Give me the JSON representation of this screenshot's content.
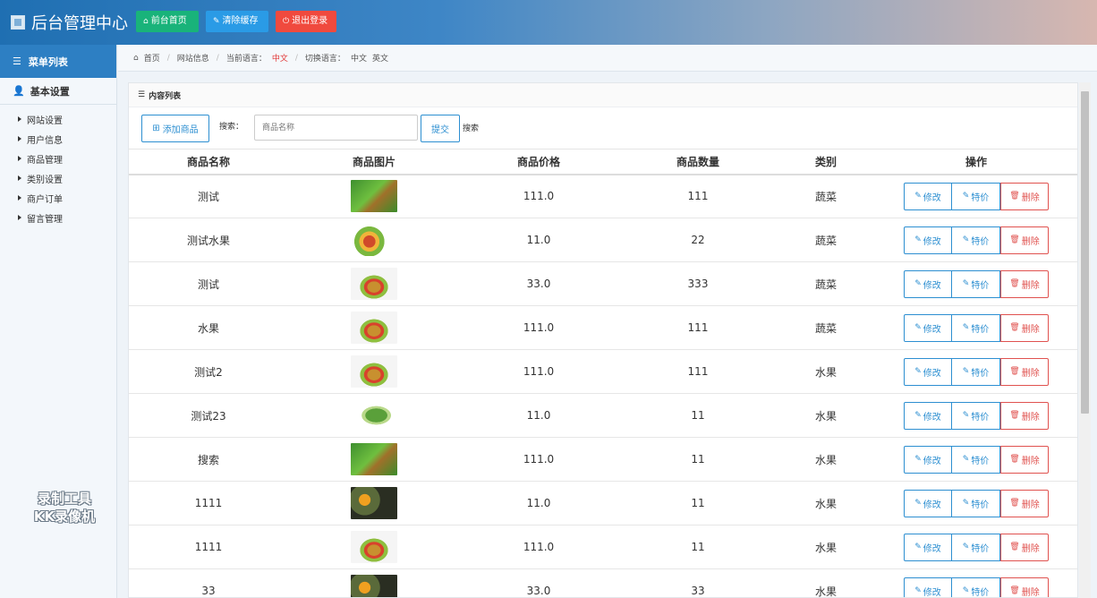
{
  "header": {
    "title": "后台管理中心",
    "buttons": {
      "home": "前台首页",
      "cache": "清除缓存",
      "logout": "退出登录"
    }
  },
  "sidebar": {
    "menu_title": "菜单列表",
    "group_title": "基本设置",
    "items": [
      "网站设置",
      "用户信息",
      "商品管理",
      "类别设置",
      "商户订单",
      "留言管理"
    ]
  },
  "breadcrumb": {
    "home": "首页",
    "page": "网站信息",
    "lang_label": "当前语言：",
    "lang_value": "中文",
    "switch_label": "切换语言：",
    "switch_zh": "中文",
    "switch_en": "英文"
  },
  "panel": {
    "title": "内容列表",
    "add_button": "添加商品",
    "search_label": "搜索：",
    "search_placeholder": "商品名称",
    "submit_button": "提交",
    "search_text": "搜索"
  },
  "table": {
    "headers": [
      "商品名称",
      "商品图片",
      "商品价格",
      "商品数量",
      "类别",
      "操作"
    ],
    "actions": {
      "edit": "修改",
      "special": "特价",
      "delete": "删除"
    },
    "rows": [
      {
        "name": "测试",
        "price": "111.0",
        "qty": "111",
        "category": "蔬菜"
      },
      {
        "name": "测试水果",
        "price": "11.0",
        "qty": "22",
        "category": "蔬菜"
      },
      {
        "name": "测试",
        "price": "33.0",
        "qty": "333",
        "category": "蔬菜"
      },
      {
        "name": "水果",
        "price": "111.0",
        "qty": "111",
        "category": "蔬菜"
      },
      {
        "name": "测试2",
        "price": "111.0",
        "qty": "111",
        "category": "水果"
      },
      {
        "name": "测试23",
        "price": "11.0",
        "qty": "11",
        "category": "水果"
      },
      {
        "name": "搜索",
        "price": "111.0",
        "qty": "11",
        "category": "水果"
      },
      {
        "name": "1111",
        "price": "11.0",
        "qty": "11",
        "category": "水果"
      },
      {
        "name": "1111",
        "price": "111.0",
        "qty": "11",
        "category": "水果"
      },
      {
        "name": "33",
        "price": "33.0",
        "qty": "33",
        "category": "水果"
      }
    ]
  },
  "watermark": {
    "line1": "录制工具",
    "line2": "KK录像机"
  }
}
